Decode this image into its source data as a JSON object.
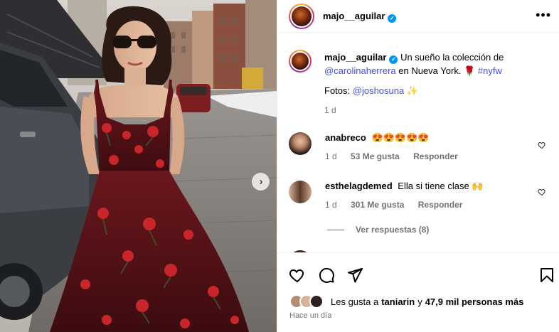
{
  "post": {
    "author": "majo__aguilar",
    "caption_text_1": "Un sueño la colección de",
    "caption_mention": "@carolinaherrera",
    "caption_text_2": "en Nueva York. 🌹",
    "caption_hashtag": "#nyfw",
    "photo_credit_label": "Fotos:",
    "photo_credit_mention": "@joshosuna",
    "photo_credit_emoji": "✨",
    "caption_age": "1 d"
  },
  "comments": [
    {
      "username": "anabreco",
      "text": "😍😍😍😍😍",
      "age": "1 d",
      "likes": "53 Me gusta",
      "reply_label": "Responder"
    },
    {
      "username": "esthelagdemed",
      "text": "Ella si tiene clase 🙌",
      "age": "1 d",
      "likes": "301 Me gusta",
      "reply_label": "Responder",
      "view_replies": "Ver respuestas (8)"
    }
  ],
  "footer": {
    "likes_prefix": "Les gusta a",
    "likes_user": "taniarin",
    "likes_joiner": "y",
    "likes_count": "47,9 mil personas más",
    "timestamp": "Hace un día"
  },
  "icons": {
    "menu": "more-horizontal-icon",
    "like": "heart-icon",
    "comment": "comment-icon",
    "share": "send-icon",
    "save": "bookmark-icon",
    "next": "chevron-right-icon"
  },
  "colors": {
    "verified": "#0095f6",
    "link": "#00376b",
    "hashtag": "#4150f7",
    "muted": "#737373",
    "dress": "#5a1418",
    "rose": "#c8262a"
  }
}
